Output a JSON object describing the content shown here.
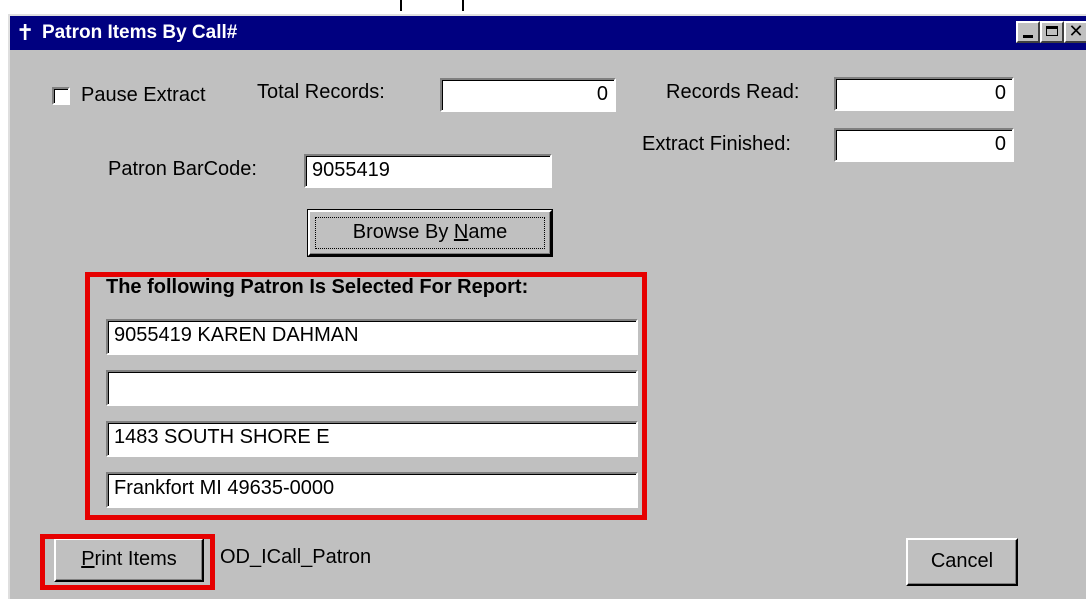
{
  "window": {
    "title": "Patron Items By Call#",
    "title_icon": "✝"
  },
  "extract": {
    "pause_label": "Pause Extract",
    "pause_checked": false,
    "total_records_label": "Total Records:",
    "total_records_value": "0",
    "records_read_label": "Records Read:",
    "records_read_value": "0",
    "extract_finished_label": "Extract Finished:",
    "extract_finished_value": "0"
  },
  "patron": {
    "barcode_label": "Patron BarCode:",
    "barcode_value": "9055419",
    "browse_button_pre": "Browse By ",
    "browse_button_accel": "N",
    "browse_button_post": "ame",
    "selected_heading": "The following Patron Is Selected For Report:",
    "line1": "9055419  KAREN DAHMAN",
    "line2": "",
    "line3": "1483 SOUTH SHORE E",
    "line4": "Frankfort MI 49635-0000"
  },
  "footer": {
    "print_accel": "P",
    "print_post": "rint Items",
    "report_name": "OD_ICall_Patron",
    "cancel_label": "Cancel"
  },
  "colors": {
    "titlebar": "#000080",
    "face": "#c0c0c0",
    "highlight": "#e60000"
  }
}
